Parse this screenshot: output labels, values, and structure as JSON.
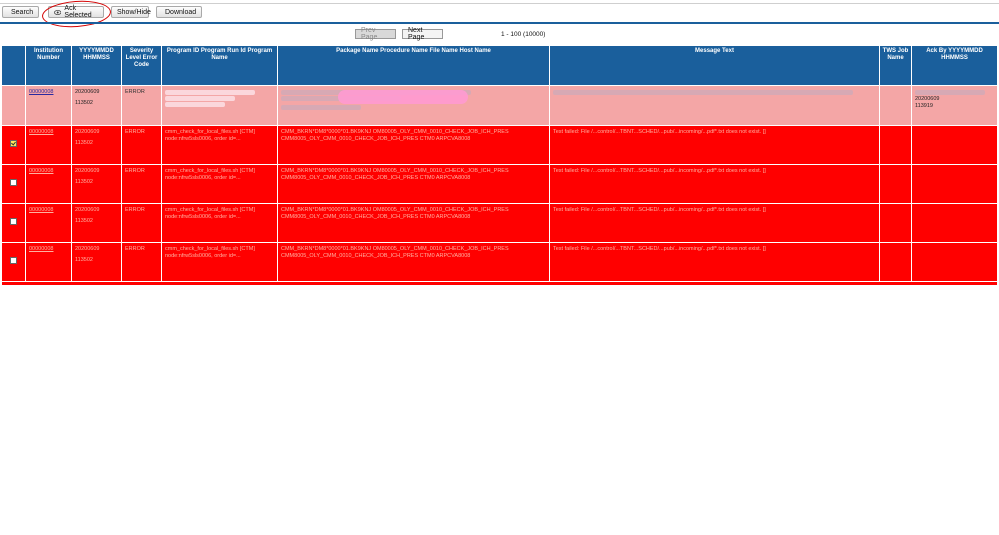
{
  "toolbar": {
    "search_label": "Search",
    "ack_label": "Ack Selected",
    "show_hide_label": "Show/Hide",
    "download_label": "Download"
  },
  "pager": {
    "prev_label": "Prev Page",
    "next_label": "Next Page",
    "range_text": "1 - 100 (10000)"
  },
  "table": {
    "headers": [
      "",
      "Institution Number",
      "YYYYMMDD HHMMSS",
      "Severity Level Error Code",
      "Program ID Program Run Id Program Name",
      "Package Name Procedure Name File Name Host Name",
      "Message Text",
      "TWS Job Name",
      "Ack By YYYYMMDD HHMMSS"
    ],
    "rows": [
      {
        "checked": false,
        "institution": "00000008",
        "date": "20200609",
        "time": "113502",
        "severity": "ERROR",
        "program": "",
        "package": "",
        "message": "",
        "tws": "",
        "ack_date": "20200609",
        "ack_time": "113919"
      },
      {
        "checked": true,
        "institution": "00000008",
        "date": "20200609",
        "time": "113502",
        "severity": "ERROR",
        "program": "cmm_check_for_local_files.sh [CTM] node:nfrw5sls0006, order id=...",
        "package": "CMM_BKRN*DM8*0000*01.BK9KNJ OM80005_OLY_CMM_0010_CHECK_JOB_ICH_PRES CMM8005_OLY_CMM_0010_CHECK_JOB_ICH_PRES CTM0 ARPCVA8008",
        "message": "Test failed: File /...control/...TBNT...SCHED/...pub/...incoming/...pdf*.txt does not exist. []",
        "tws": "",
        "ack_date": "",
        "ack_time": ""
      },
      {
        "checked": false,
        "institution": "00000008",
        "date": "20200609",
        "time": "113502",
        "severity": "ERROR",
        "program": "cmm_check_for_local_files.sh [CTM] node:nfrw5sls0006, order id=...",
        "package": "CMM_BKRN*DM8*0000*01.BK9KNJ OM80005_OLY_CMM_0010_CHECK_JOB_ICH_PRES CMM8005_OLY_CMM_0010_CHECK_JOB_ICH_PRES CTM0 ARPCVA8008",
        "message": "Test failed: File /...control/...TBNT...SCHED/...pub/...incoming/...pdf*.txt does not exist. []",
        "tws": "",
        "ack_date": "",
        "ack_time": ""
      },
      {
        "checked": false,
        "institution": "00000008",
        "date": "20200609",
        "time": "113502",
        "severity": "ERROR",
        "program": "cmm_check_for_local_files.sh [CTM] node:nfrw5sls0006, order id=...",
        "package": "CMM_BKRN*DM8*0000*01.BK9KNJ OM80005_OLY_CMM_0010_CHECK_JOB_ICH_PRES CMM8005_OLY_CMM_0010_CHECK_JOB_ICH_PRES CTM0 ARPCVA8008",
        "message": "Test failed: File /...control/...TBNT...SCHED/...pub/...incoming/...pdf*.txt does not exist. []",
        "tws": "",
        "ack_date": "",
        "ack_time": ""
      },
      {
        "checked": false,
        "institution": "00000008",
        "date": "20200609",
        "time": "113502",
        "severity": "ERROR",
        "program": "cmm_check_for_local_files.sh [CTM] node:nfrw5sls0006, order id=...",
        "package": "CMM_BKRN*DM8*0000*01.BK9KNJ OM80005_OLY_CMM_0010_CHECK_JOB_ICH_PRES CMM8005_OLY_CMM_0010_CHECK_JOB_ICH_PRES CTM0 ARPCVA8008",
        "message": "Test failed: File /...control/...TBNT...SCHED/...pub/...incoming/...pdf*.txt does not exist. []",
        "tws": "",
        "ack_date": "",
        "ack_time": ""
      }
    ]
  },
  "colors": {
    "header_blue": "#1a5f9c",
    "row_pink": "#f4a6a6",
    "row_red": "#ff0000",
    "annotation_red": "#d40000"
  },
  "icons": [
    "search-icon",
    "ack-eye-icon",
    "download-icon"
  ]
}
